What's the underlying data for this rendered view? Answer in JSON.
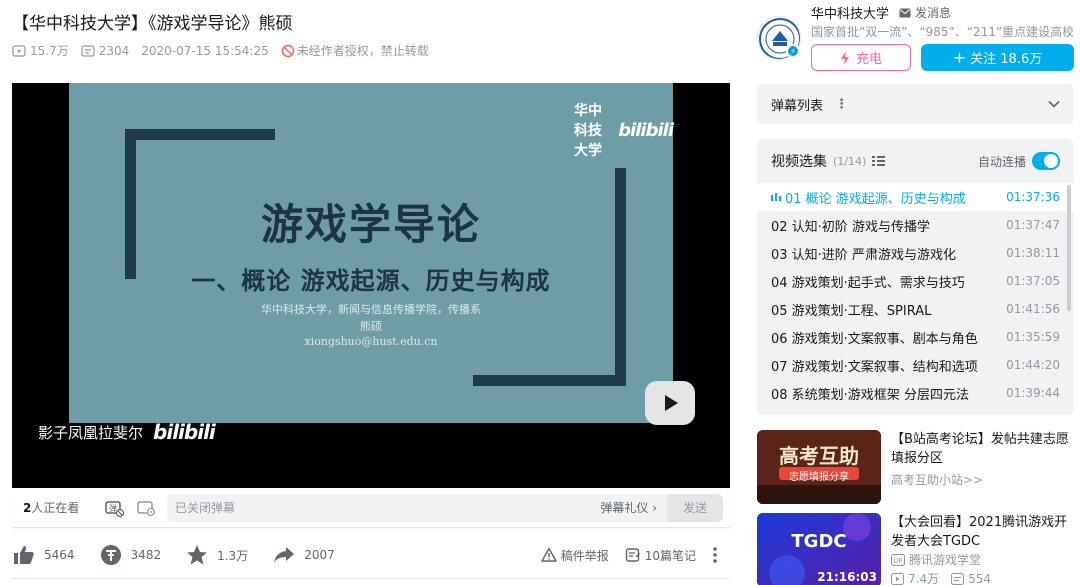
{
  "video": {
    "title": "【华中科技大学】《游戏学导论》熊硕",
    "views": "15.7万",
    "danmaku": "2304",
    "date": "2020-07-15 15:54:25",
    "copyright": "未经作者授权，禁止转载"
  },
  "player": {
    "slide_title": "游戏学导论",
    "slide_subtitle": "一、概论  游戏起源、历史与构成",
    "slide_line1": "华中科技大学，新闻与信息传播学院，传播系",
    "slide_line2": "熊硕",
    "slide_line3": "xiongshuo@hust.edu.cn",
    "watermark_top": "华中科技大学",
    "watermark_bottom": "影子凤凰拉斐尔",
    "bili_logo": "bilibili"
  },
  "danmaku_bar": {
    "watching_count": "2",
    "watching_suffix": "人正在看",
    "placeholder": "已关闭弹幕",
    "etiquette": "弹幕礼仪 ›",
    "send": "发送"
  },
  "toolbar": {
    "like": "5464",
    "coin": "3482",
    "favorite": "1.3万",
    "share": "2007",
    "report": "稿件举报",
    "notes": "10篇笔记"
  },
  "uploader": {
    "name": "华中科技大学",
    "message": "发消息",
    "desc": "国家首批“双一流”、“985”、“211”重点建设高校，...",
    "charge": "充电",
    "follow": "关注 18.6万"
  },
  "danmaku_list": {
    "label": "弹幕列表"
  },
  "playlist": {
    "title": "视频选集",
    "count": "(1/14)",
    "autoplay": "自动连播",
    "items": [
      {
        "title": "01 概论 游戏起源、历史与构成",
        "duration": "01:37:36"
      },
      {
        "title": "02 认知·初阶 游戏与传播学",
        "duration": "01:37:47"
      },
      {
        "title": "03 认知·进阶 严肃游戏与游戏化",
        "duration": "01:38:11"
      },
      {
        "title": "04 游戏策划·起手式、需求与技巧",
        "duration": "01:37:05"
      },
      {
        "title": "05 游戏策划·工程、SPIRAL",
        "duration": "01:41:56"
      },
      {
        "title": "06 游戏策划·文案叙事、剧本与角色",
        "duration": "01:35:59"
      },
      {
        "title": "07 游戏策划·文案叙事、结构和选项",
        "duration": "01:44:20"
      },
      {
        "title": "08 系统策划·游戏框架 分层四元法",
        "duration": "01:39:44"
      }
    ]
  },
  "recommendations": [
    {
      "title": "【B站高考论坛】发帖共建志愿填报分区",
      "author": "高考互助小站>>",
      "thumb_text1": "高考互助",
      "thumb_text2": "志愿填报分享"
    },
    {
      "title": "【大会回看】2021腾讯游戏开发者大会TGDC",
      "author": "腾讯游戏学堂",
      "views": "7.4万",
      "danmaku": "554",
      "duration": "21:16:03",
      "thumb_text1": "TGDC"
    }
  ],
  "colors": {
    "accent": "#00aeec",
    "charge": "#ff6699",
    "slide_bg": "#6e9da7",
    "slide_dark": "#1e3a4c"
  }
}
